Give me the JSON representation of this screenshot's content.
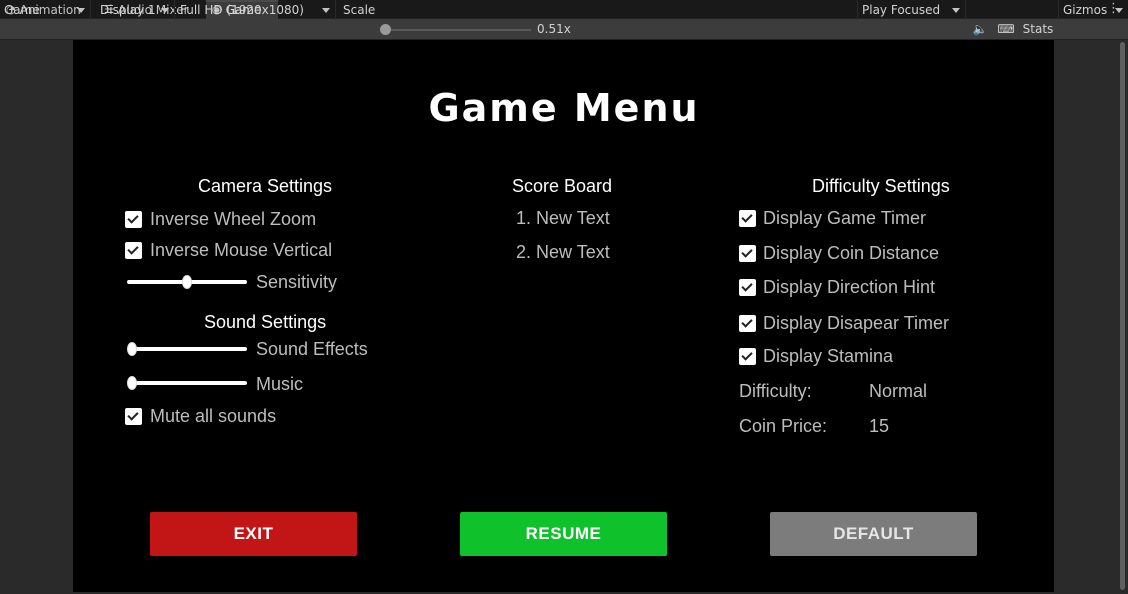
{
  "tabs": [
    {
      "label": "Animation",
      "icon": "animation-icon"
    },
    {
      "label": "Audio Mixer",
      "icon": "audio-mixer-icon"
    },
    {
      "label": "Game",
      "icon": "gamepad-icon"
    }
  ],
  "toolbar": {
    "view_mode": "Game",
    "display": "Display 1",
    "resolution": "Full HD (1920x1080)",
    "scale_label": "Scale",
    "scale_value": "0.51x",
    "play_mode": "Play Focused",
    "stats_label": "Stats",
    "gizmos_label": "Gizmos"
  },
  "game": {
    "title": "Game Menu",
    "camera": {
      "title": "Camera Settings",
      "inverse_wheel_zoom": "Inverse Wheel Zoom",
      "inverse_mouse_vertical": "Inverse Mouse Vertical",
      "sensitivity_label": "Sensitivity",
      "sensitivity_level": 0.5
    },
    "sound": {
      "title": "Sound Settings",
      "effects_label": "Sound Effects",
      "effects_level": 0.0,
      "music_label": "Music",
      "music_level": 0.0,
      "mute_label": "Mute all sounds"
    },
    "scoreboard": {
      "title": "Score Board",
      "entries": [
        "1. New Text",
        "2. New Text"
      ]
    },
    "difficulty": {
      "title": "Difficulty Settings",
      "options": [
        "Display Game Timer",
        "Display Coin Distance",
        "Display Direction Hint",
        "Display Disapear Timer",
        "Display Stamina"
      ],
      "difficulty_label": "Difficulty:",
      "difficulty_value": "Normal",
      "coin_price_label": "Coin Price:",
      "coin_price_value": "15"
    },
    "buttons": {
      "exit": "EXIT",
      "resume": "RESUME",
      "default": "DEFAULT"
    }
  },
  "colors": {
    "exit": "#c21616",
    "resume": "#0fc12a",
    "default": "#7c7c7c"
  }
}
